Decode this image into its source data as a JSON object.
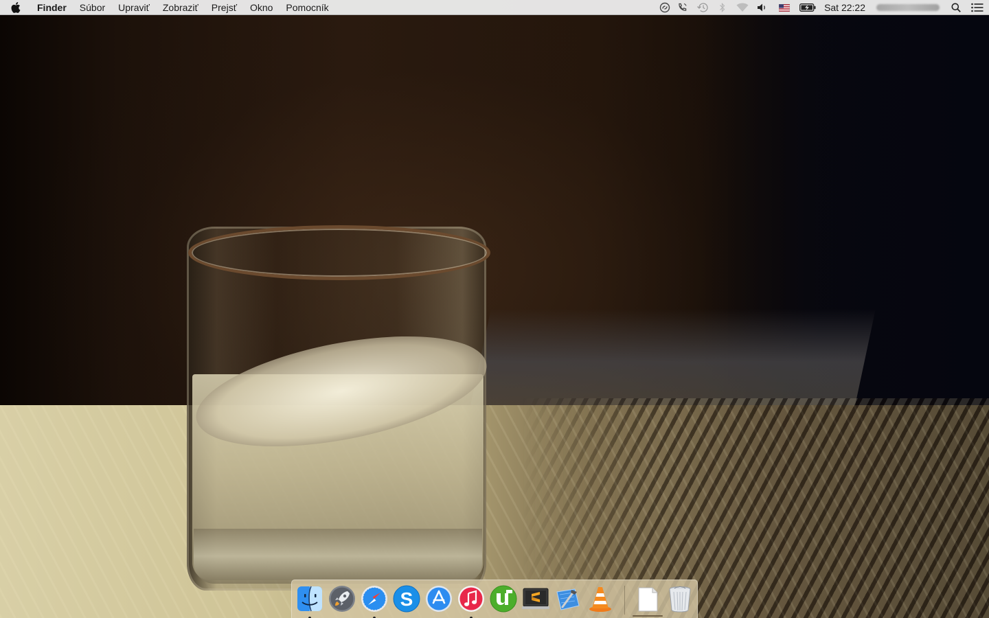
{
  "menubar": {
    "apple_icon": "apple-icon",
    "app_name": "Finder",
    "menus": [
      "Súbor",
      "Upraviť",
      "Zobraziť",
      "Prejsť",
      "Okno",
      "Pomocník"
    ],
    "status_icons": [
      "sync-icon",
      "phone-icon",
      "time-machine-icon",
      "bluetooth-icon",
      "wifi-icon",
      "volume-icon",
      "us-flag-icon",
      "battery-icon"
    ],
    "clock": "Sat 22:22",
    "right_icons": [
      "spotlight-search-icon",
      "notification-center-icon"
    ]
  },
  "dock": {
    "apps": [
      {
        "name": "Finder",
        "icon": "finder-icon",
        "running": true
      },
      {
        "name": "Launchpad",
        "icon": "launchpad-icon",
        "running": false
      },
      {
        "name": "Safari",
        "icon": "safari-icon",
        "running": true
      },
      {
        "name": "Skype",
        "icon": "skype-icon",
        "running": false
      },
      {
        "name": "App Store",
        "icon": "app-store-icon",
        "running": false
      },
      {
        "name": "iTunes",
        "icon": "itunes-icon",
        "running": true
      },
      {
        "name": "uTorrent",
        "icon": "utorrent-icon",
        "running": false
      },
      {
        "name": "Sublime Text",
        "icon": "sublime-text-icon",
        "running": false
      },
      {
        "name": "Xcode",
        "icon": "xcode-icon",
        "running": false
      },
      {
        "name": "VLC",
        "icon": "vlc-icon",
        "running": false
      }
    ],
    "others": [
      {
        "name": "Documents",
        "icon": "document-stack-icon"
      },
      {
        "name": "Trash",
        "icon": "trash-icon"
      }
    ],
    "colors": {
      "dock_bg": "#d6c8a5",
      "itunes": "#e8284a",
      "skype": "#1a8fe8",
      "utorrent": "#4cae2b",
      "vlc": "#f07b1a"
    }
  }
}
